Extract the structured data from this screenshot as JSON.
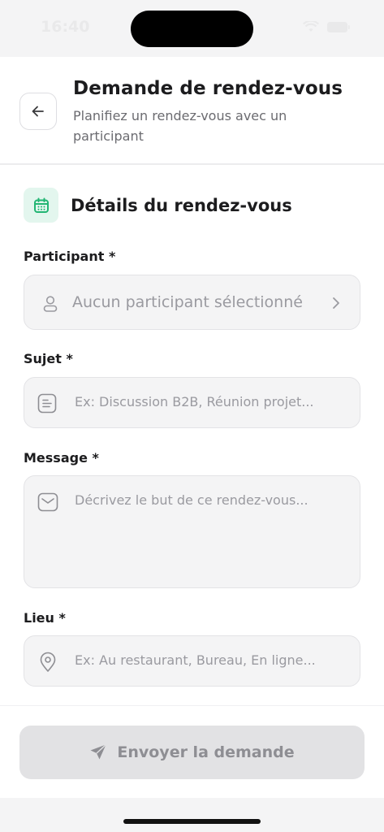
{
  "status_bar": {
    "time": "16:40"
  },
  "header": {
    "title": "Demande de rendez-vous",
    "subtitle": "Planifiez un rendez-vous avec un participant"
  },
  "section": {
    "title": "Détails du rendez-vous"
  },
  "form": {
    "participant": {
      "label": "Participant *",
      "placeholder": "Aucun participant sélectionné"
    },
    "subject": {
      "label": "Sujet *",
      "placeholder": "Ex: Discussion B2B, Réunion projet..."
    },
    "message": {
      "label": "Message *",
      "placeholder": "Décrivez le but de ce rendez-vous..."
    },
    "location": {
      "label": "Lieu *",
      "placeholder": "Ex: Au restaurant, Bureau, En ligne..."
    }
  },
  "footer": {
    "submit_label": "Envoyer la demande"
  },
  "colors": {
    "accent": "#22b573",
    "accent_bg": "#e3f6ee",
    "disabled_bg": "#e2e2e4"
  }
}
